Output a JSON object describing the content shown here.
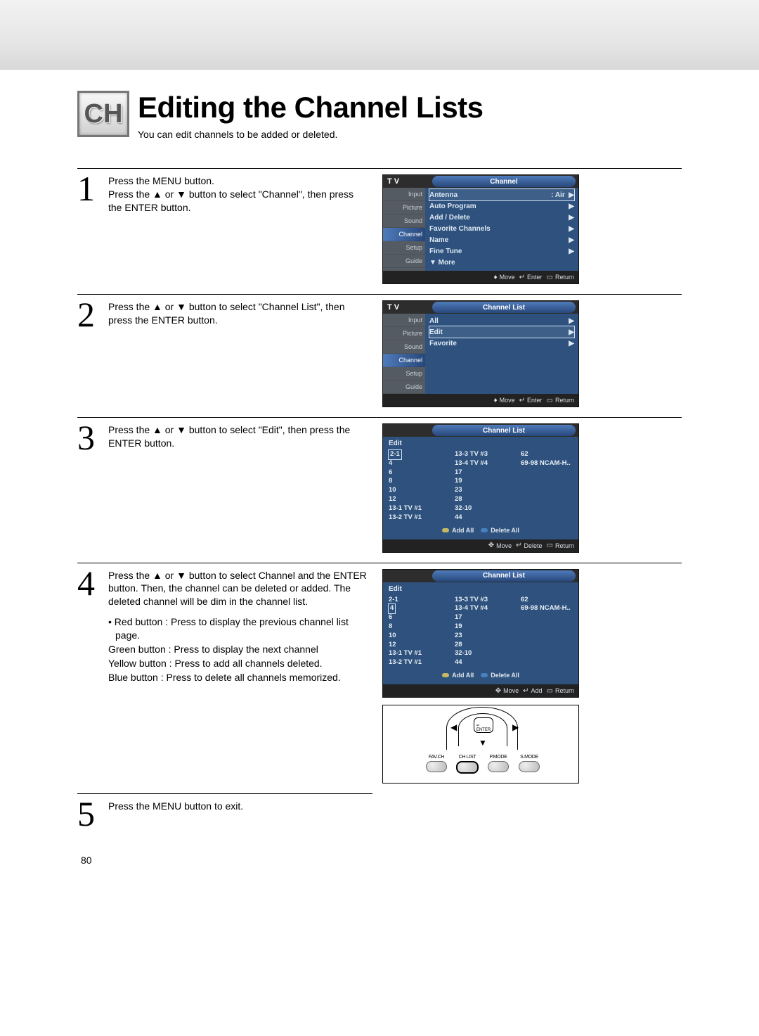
{
  "page_number": "80",
  "badge": "CH",
  "title": "Editing the Channel Lists",
  "subtitle": "You can edit channels to be added or deleted.",
  "steps": {
    "s1": {
      "num": "1",
      "line1": "Press the MENU button.",
      "line2a": "Press the ▲ or ▼ button to select \"Channel\", then press the ENTER button."
    },
    "s2": {
      "num": "2",
      "text": "Press the ▲ or ▼ button to select \"Channel List\", then press the ENTER button."
    },
    "s3": {
      "num": "3",
      "text": "Press the ▲ or ▼ button to select \"Edit\", then press the ENTER button."
    },
    "s4": {
      "num": "4",
      "text": "Press the ▲ or ▼ button to select Channel and the ENTER button. Then, the channel can be deleted or added. The deleted channel will be dim in the channel list.",
      "b1": "• Red button : Press to display the previous channel list page.",
      "b2": "Green button : Press to display the next channel",
      "b3": "Yellow button : Press to add all channels deleted.",
      "b4": "Blue button    : Press to delete all channels memorized."
    },
    "s5": {
      "num": "5",
      "text": "Press the MENU button to exit."
    }
  },
  "osd1": {
    "tv": "T V",
    "tab": "Channel",
    "side": [
      "Input",
      "Picture",
      "Sound",
      "Channel",
      "Setup",
      "Guide"
    ],
    "rows": [
      {
        "l": "Antenna",
        "r": ": Air",
        "arrow": "▶"
      },
      {
        "l": "Auto Program",
        "r": "",
        "arrow": "▶"
      },
      {
        "l": "Add / Delete",
        "r": "",
        "arrow": "▶"
      },
      {
        "l": "Favorite Channels",
        "r": "",
        "arrow": "▶"
      },
      {
        "l": "Name",
        "r": "",
        "arrow": "▶"
      },
      {
        "l": "Fine Tune",
        "r": "",
        "arrow": "▶"
      },
      {
        "l": "▼ More",
        "r": "",
        "arrow": ""
      }
    ],
    "hints": {
      "move": "Move",
      "enter": "Enter",
      "ret": "Return"
    }
  },
  "osd2": {
    "tv": "T V",
    "tab": "Channel List",
    "side": [
      "Input",
      "Picture",
      "Sound",
      "Channel",
      "Setup",
      "Guide"
    ],
    "rows": [
      {
        "l": "All",
        "r": "",
        "arrow": "▶"
      },
      {
        "l": "Edit",
        "r": "",
        "arrow": "▶",
        "sel": true
      },
      {
        "l": "Favorite",
        "r": "",
        "arrow": "▶"
      }
    ],
    "hints": {
      "move": "Move",
      "enter": "Enter",
      "ret": "Return"
    }
  },
  "osd3": {
    "tab": "Channel List",
    "edit": "Edit",
    "col1": [
      "2-1",
      "4",
      "6",
      "8",
      "10",
      "12",
      "13-1 TV #1",
      "13-2 TV #1"
    ],
    "col2": [
      "13-3 TV #3",
      "13-4 TV #4",
      "17",
      "19",
      "23",
      "28",
      "32-10",
      "44"
    ],
    "col3": [
      "62",
      "69-98 NCAM-H.."
    ],
    "sel_index": 0,
    "addall": "Add All",
    "delall": "Delete All",
    "hints": {
      "move": "Move",
      "mid": "Delete",
      "ret": "Return"
    }
  },
  "osd4": {
    "tab": "Channel List",
    "edit": "Edit",
    "col1": [
      "2-1",
      "4",
      "6",
      "8",
      "10",
      "12",
      "13-1 TV #1",
      "13-2 TV #1"
    ],
    "col2": [
      "13-3 TV #3",
      "13-4 TV #4",
      "17",
      "19",
      "23",
      "28",
      "32-10",
      "44"
    ],
    "col3": [
      "62",
      "69-98 NCAM-H.."
    ],
    "sel_index": 1,
    "addall": "Add All",
    "delall": "Delete All",
    "hints": {
      "move": "Move",
      "mid": "Add",
      "ret": "Return"
    }
  },
  "remote": {
    "enter": "ENTER",
    "btns": [
      "FAV.CH",
      "CH LIST",
      "P.MODE",
      "S.MODE"
    ]
  }
}
